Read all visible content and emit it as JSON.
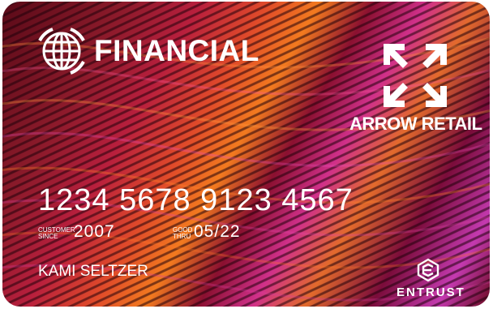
{
  "card": {
    "brand_name": "FINANCIAL",
    "retailer_name": "ARROW RETAIL",
    "card_number": "1234 5678 9123 4567",
    "customer_since_label_line1": "CUSTOMER",
    "customer_since_label_line2": "SINCE",
    "customer_since_value": "2007",
    "good_thru_label_line1": "GOOD",
    "good_thru_label_line2": "THRU",
    "good_thru_value": "05/22",
    "cardholder_name": "KAMI SELTZER",
    "issuer_logo_text": "ENTRUST"
  },
  "icons": {
    "brand": "globe-icon",
    "retailer": "expand-arrows-icon",
    "issuer": "entrust-cube-icon"
  },
  "colors": {
    "text": "#ffffff",
    "base_dark": "#5a0a18",
    "red": "#b81f3d",
    "orange": "#f27a1f",
    "magenta": "#d0308a"
  }
}
